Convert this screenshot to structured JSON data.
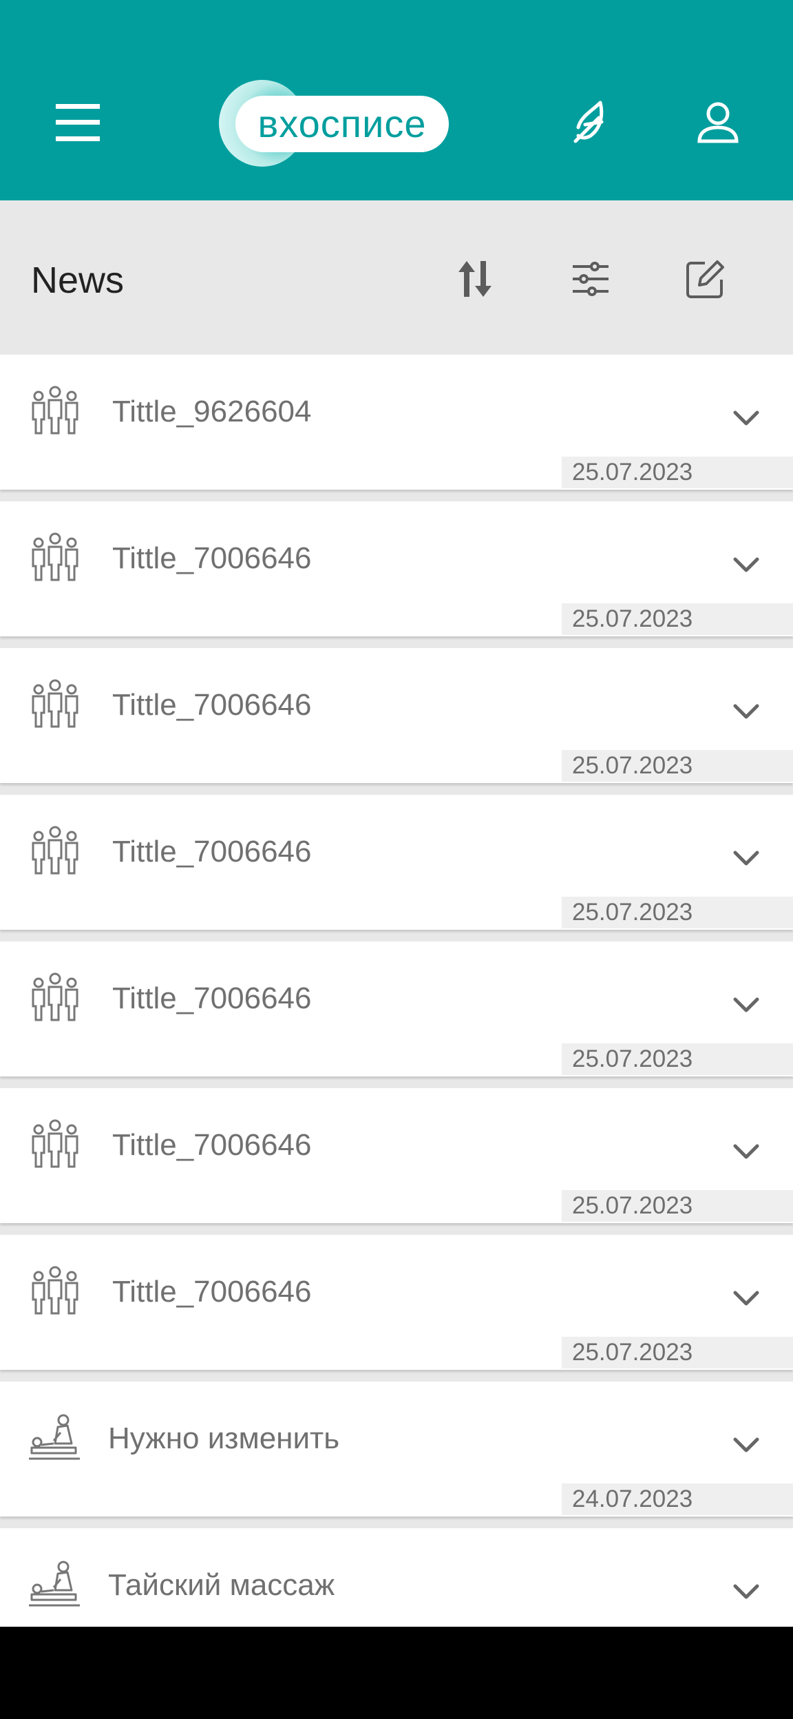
{
  "header": {
    "logo_text": "вхосписе",
    "brand_color": "#029e9e",
    "menu_icon": "hamburger-icon",
    "leaf_icon": "feather-icon",
    "user_icon": "user-icon"
  },
  "toolbar": {
    "title": "News",
    "sort_icon": "sort-icon",
    "filter_icon": "sliders-icon",
    "edit_icon": "edit-icon"
  },
  "news": {
    "items": [
      {
        "title": "Tittle_9626604",
        "date": "25.07.2023",
        "icon": "people-group-icon"
      },
      {
        "title": "Tittle_7006646",
        "date": "25.07.2023",
        "icon": "people-group-icon"
      },
      {
        "title": "Tittle_7006646",
        "date": "25.07.2023",
        "icon": "people-group-icon"
      },
      {
        "title": "Tittle_7006646",
        "date": "25.07.2023",
        "icon": "people-group-icon"
      },
      {
        "title": "Tittle_7006646",
        "date": "25.07.2023",
        "icon": "people-group-icon"
      },
      {
        "title": "Tittle_7006646",
        "date": "25.07.2023",
        "icon": "people-group-icon"
      },
      {
        "title": "Tittle_7006646",
        "date": "25.07.2023",
        "icon": "people-group-icon"
      },
      {
        "title": "Нужно изменить",
        "date": "24.07.2023",
        "icon": "massage-icon"
      },
      {
        "title": "Тайский массаж",
        "date": "",
        "icon": "massage-icon"
      }
    ]
  }
}
